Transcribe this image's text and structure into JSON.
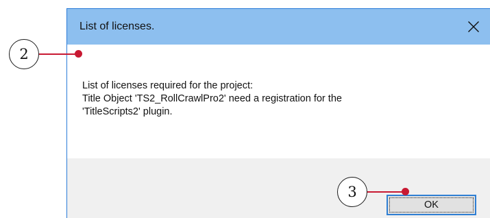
{
  "dialog": {
    "title": "List of licenses.",
    "close_icon": "close-icon",
    "message_lines": [
      "List of licenses required for the project:",
      "Title Object 'TS2_RollCrawlPro2' need a registration for the",
      "'TitleScripts2' plugin."
    ],
    "ok_label": "OK"
  },
  "callouts": [
    {
      "number": "2"
    },
    {
      "number": "3"
    }
  ],
  "colors": {
    "titlebar": "#8dbfef",
    "window_border": "#2a7bd8",
    "footer": "#f0f0f0",
    "ok_button_border": "#2f7fd3",
    "callout_accent": "#c81932"
  }
}
